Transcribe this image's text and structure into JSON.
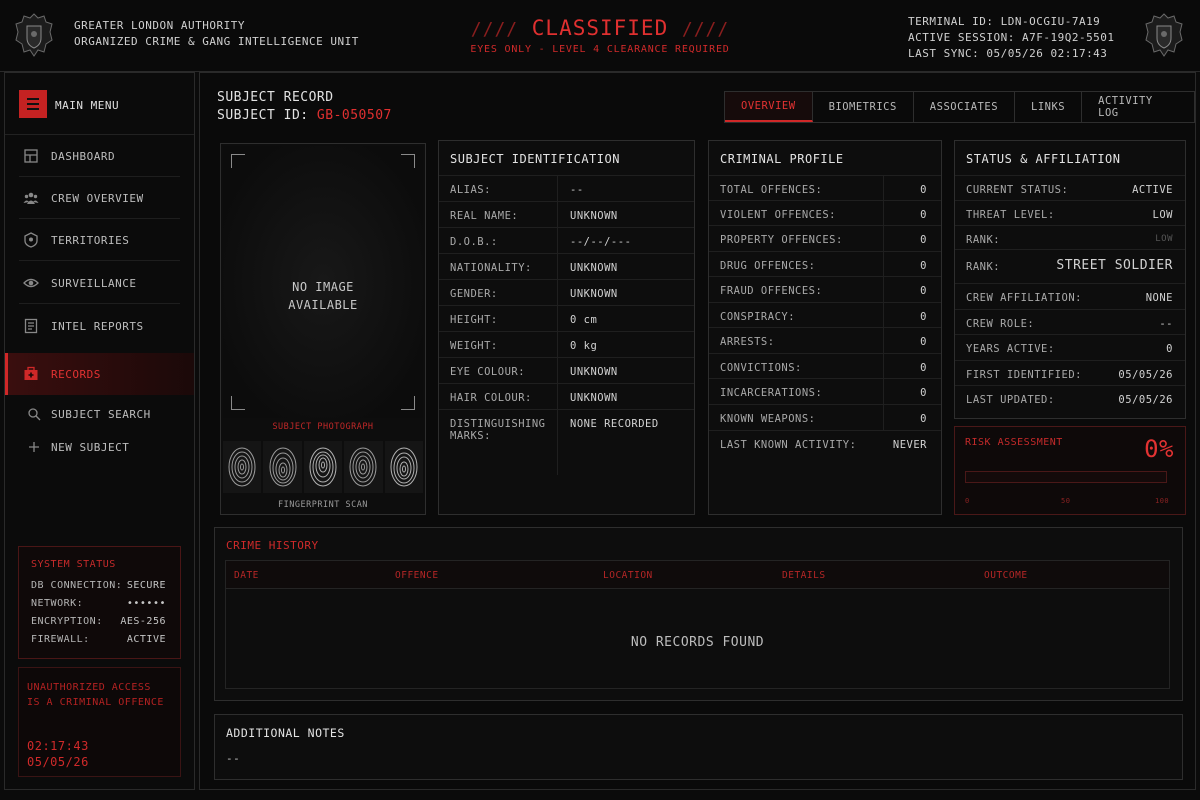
{
  "header": {
    "org_line1": "GREATER LONDON AUTHORITY",
    "org_line2": "ORGANIZED CRIME & GANG INTELLIGENCE UNIT",
    "slashes_left": "////",
    "classified": "CLASSIFIED",
    "slashes_right": "////",
    "eyes_only": "EYES ONLY - LEVEL 4 CLEARANCE REQUIRED",
    "terminal_id": "TERMINAL ID: LDN-OCGIU-7A19",
    "active_session": "ACTIVE SESSION: A7F-19Q2-5501",
    "last_sync": "LAST SYNC: 05/05/26 02:17:43"
  },
  "sidebar": {
    "menu_label": "MAIN MENU",
    "items": [
      {
        "label": "DASHBOARD",
        "icon": "dashboard-icon"
      },
      {
        "label": "CREW OVERVIEW",
        "icon": "crew-icon"
      },
      {
        "label": "TERRITORIES",
        "icon": "territories-icon"
      },
      {
        "label": "SURVEILLANCE",
        "icon": "eye-icon"
      },
      {
        "label": "INTEL REPORTS",
        "icon": "document-icon"
      },
      {
        "label": "RECORDS",
        "icon": "records-icon",
        "active": true
      }
    ],
    "sub_items": [
      {
        "label": "SUBJECT SEARCH",
        "icon": "search-icon"
      },
      {
        "label": "NEW SUBJECT",
        "icon": "plus-icon"
      }
    ],
    "system_status": {
      "title": "SYSTEM STATUS",
      "rows": [
        {
          "k": "DB CONNECTION:",
          "v": "SECURE"
        },
        {
          "k": "NETWORK:",
          "v": "••••••"
        },
        {
          "k": "ENCRYPTION:",
          "v": "AES-256"
        },
        {
          "k": "FIREWALL:",
          "v": "ACTIVE"
        }
      ]
    },
    "warning_line1": "UNAUTHORIZED ACCESS",
    "warning_line2": "IS A CRIMINAL OFFENCE",
    "clock_time": "02:17:43",
    "clock_date": "05/05/26"
  },
  "record": {
    "title": "SUBJECT RECORD",
    "id_label": "SUBJECT ID:",
    "id_value": "GB-050507"
  },
  "tabs": [
    {
      "label": "OVERVIEW",
      "active": true
    },
    {
      "label": "BIOMETRICS"
    },
    {
      "label": "ASSOCIATES"
    },
    {
      "label": "LINKS"
    },
    {
      "label": "ACTIVITY LOG"
    }
  ],
  "photo": {
    "no_image_1": "NO IMAGE",
    "no_image_2": "AVAILABLE",
    "photo_label": "SUBJECT PHOTOGRAPH",
    "fingerprint_label": "FINGERPRINT SCAN"
  },
  "identification": {
    "title": "SUBJECT IDENTIFICATION",
    "rows": [
      {
        "k": "ALIAS:",
        "v": "--"
      },
      {
        "k": "REAL NAME:",
        "v": "UNKNOWN"
      },
      {
        "k": "D.O.B.:",
        "v": "--/--/---"
      },
      {
        "k": "NATIONALITY:",
        "v": "UNKNOWN"
      },
      {
        "k": "GENDER:",
        "v": "UNKNOWN"
      },
      {
        "k": "HEIGHT:",
        "v": "0 cm"
      },
      {
        "k": "WEIGHT:",
        "v": "0 kg"
      },
      {
        "k": "EYE COLOUR:",
        "v": "UNKNOWN"
      },
      {
        "k": "HAIR COLOUR:",
        "v": "UNKNOWN"
      },
      {
        "k": "DISTINGUISHING",
        "k2": "MARKS:",
        "v": "NONE RECORDED"
      }
    ]
  },
  "criminal": {
    "title": "CRIMINAL PROFILE",
    "rows": [
      {
        "k": "TOTAL OFFENCES:",
        "v": "0"
      },
      {
        "k": "VIOLENT OFFENCES:",
        "v": "0"
      },
      {
        "k": "PROPERTY OFFENCES:",
        "v": "0"
      },
      {
        "k": "DRUG OFFENCES:",
        "v": "0"
      },
      {
        "k": "FRAUD OFFENCES:",
        "v": "0"
      },
      {
        "k": "CONSPIRACY:",
        "v": "0"
      },
      {
        "k": "ARRESTS:",
        "v": "0"
      },
      {
        "k": "CONVICTIONS:",
        "v": "0"
      },
      {
        "k": "INCARCERATIONS:",
        "v": "0"
      },
      {
        "k": "KNOWN WEAPONS:",
        "v": "0"
      },
      {
        "k": "LAST KNOWN ACTIVITY:",
        "v": "NEVER"
      }
    ]
  },
  "status": {
    "title": "STATUS & AFFILIATION",
    "rows": [
      {
        "k": "CURRENT STATUS:",
        "v": "ACTIVE",
        "red": true
      },
      {
        "k": "THREAT LEVEL:",
        "v": "LOW"
      },
      {
        "k": "RANK:",
        "v": "LOW",
        "faded": true
      },
      {
        "k": "RANK:",
        "v": "STREET SOLDIER",
        "red": true,
        "big": true
      },
      {
        "k": "CREW AFFILIATION:",
        "v": "NONE"
      },
      {
        "k": "CREW ROLE:",
        "v": "--"
      },
      {
        "k": "YEARS ACTIVE:",
        "v": "0"
      },
      {
        "k": "FIRST IDENTIFIED:",
        "v": "05/05/26"
      },
      {
        "k": "LAST UPDATED:",
        "v": "05/05/26"
      }
    ]
  },
  "risk": {
    "title": "RISK ASSESSMENT",
    "value": "0%",
    "fraction": 0,
    "ticks": [
      "0",
      "50",
      "100"
    ]
  },
  "crime_history": {
    "title": "CRIME HISTORY",
    "columns": [
      "DATE",
      "OFFENCE",
      "LOCATION",
      "DETAILS",
      "OUTCOME"
    ],
    "empty": "NO RECORDS FOUND"
  },
  "notes": {
    "title": "ADDITIONAL NOTES",
    "value": "--"
  },
  "colors": {
    "accent": "#e03030",
    "background": "#0b0b0b"
  }
}
